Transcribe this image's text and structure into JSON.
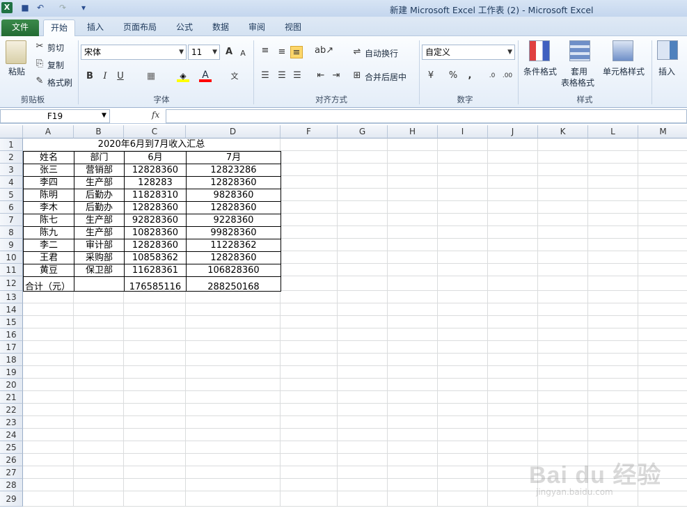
{
  "window": {
    "title": "新建 Microsoft Excel 工作表 (2)  -  Microsoft Excel"
  },
  "tabs": [
    "文件",
    "开始",
    "插入",
    "页面布局",
    "公式",
    "数据",
    "审阅",
    "视图"
  ],
  "ribbon": {
    "clipboard": {
      "paste": "粘贴",
      "cut": "剪切",
      "copy": "复制",
      "format_painter": "格式刷",
      "label": "剪贴板"
    },
    "font": {
      "name": "宋体",
      "size": "11",
      "bold": "B",
      "italic": "I",
      "underline": "U",
      "label": "字体"
    },
    "alignment": {
      "wrap": "自动换行",
      "merge": "合并后居中",
      "label": "对齐方式"
    },
    "number": {
      "format": "自定义",
      "percent": "%",
      "comma": ",",
      "label": "数字"
    },
    "styles": {
      "conditional": "条件格式",
      "table1": "套用",
      "table2": "表格格式",
      "cell_styles": "单元格样式",
      "label": "样式"
    },
    "cells": {
      "insert": "插入"
    }
  },
  "formula_bar": {
    "name_box": "F19",
    "fx": "fx",
    "content": ""
  },
  "columns": [
    "A",
    "B",
    "C",
    "D",
    "F",
    "G",
    "H",
    "I",
    "J",
    "K",
    "L",
    "M"
  ],
  "sheet": {
    "title": "2020年6月到7月收入汇总",
    "headers": [
      "姓名",
      "部门",
      "6月",
      "7月"
    ],
    "rows": [
      [
        "张三",
        "营销部",
        "12828360",
        "12823286"
      ],
      [
        "李四",
        "生产部",
        "128283",
        "12828360"
      ],
      [
        "陈明",
        "后勤办",
        "11828310",
        "9828360"
      ],
      [
        "李木",
        "后勤办",
        "12828360",
        "12828360"
      ],
      [
        "陈七",
        "生产部",
        "92828360",
        "9228360"
      ],
      [
        "陈九",
        "生产部",
        "10828360",
        "99828360"
      ],
      [
        "李二",
        "审计部",
        "12828360",
        "11228362"
      ],
      [
        "王君",
        "采购部",
        "10858362",
        "12828360"
      ],
      [
        "黄豆",
        "保卫部",
        "11628361",
        "106828360"
      ]
    ],
    "total": [
      "合计（元）",
      "",
      "176585116",
      "288250168"
    ]
  },
  "row_numbers": [
    "1",
    "2",
    "3",
    "4",
    "5",
    "6",
    "7",
    "8",
    "9",
    "10",
    "11",
    "12",
    "13",
    "14",
    "15",
    "16",
    "17",
    "18",
    "19",
    "20",
    "21",
    "22",
    "23",
    "24",
    "25",
    "26",
    "27",
    "28",
    "29"
  ],
  "watermark": {
    "main": "Bai du 经验",
    "sub": "jingyan.baidu.com"
  }
}
